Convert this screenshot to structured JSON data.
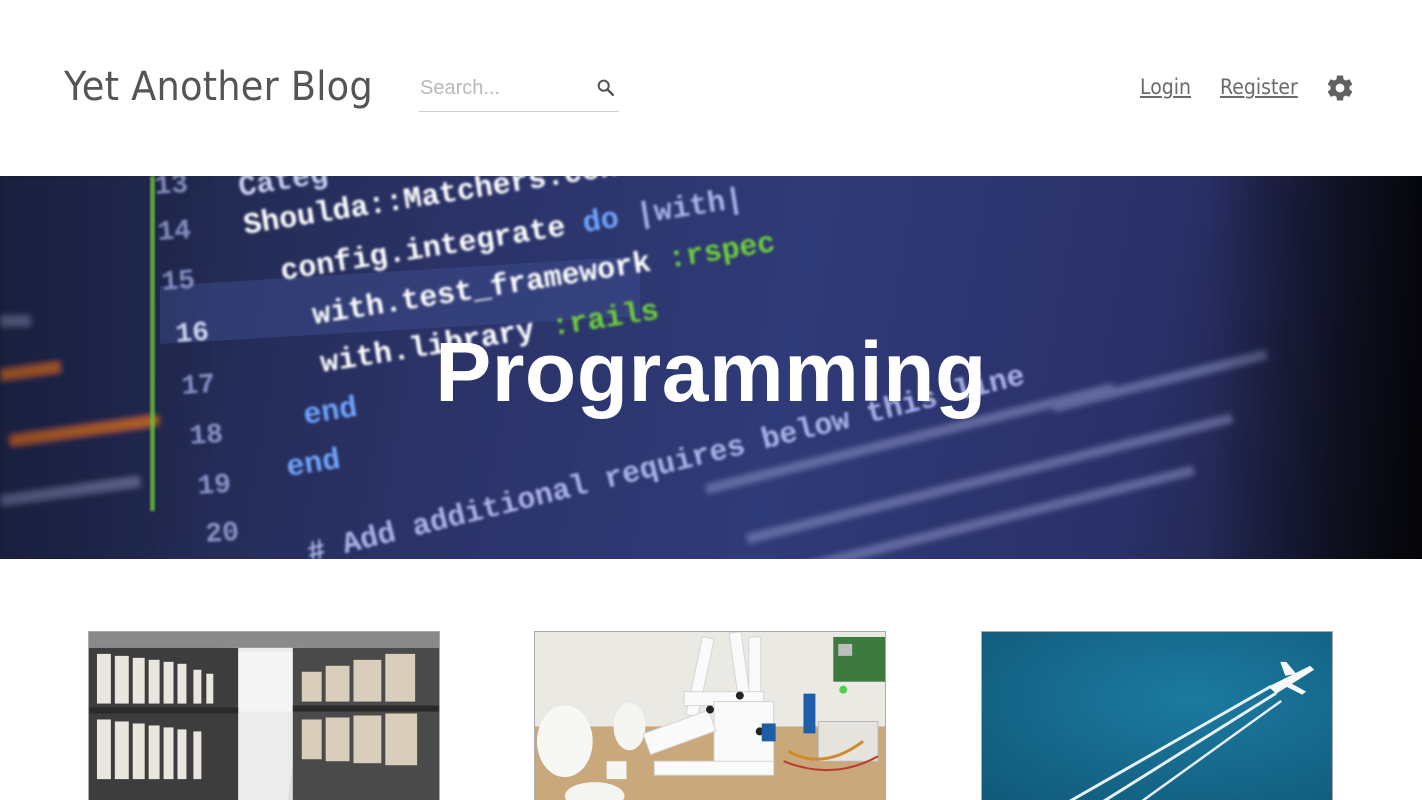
{
  "header": {
    "site_title": "Yet Another Blog",
    "search": {
      "placeholder": "Search...",
      "value": "",
      "icon": "search-icon"
    },
    "nav": {
      "login": "Login",
      "register": "Register",
      "settings_icon": "gear-icon"
    }
  },
  "hero": {
    "title": "Programming",
    "code_lines": [
      {
        "num": "13",
        "text": "Categ..."
      },
      {
        "num": "14",
        "text": "Shoulda::Matchers.configure do |config|"
      },
      {
        "num": "15",
        "text": "config.integrate do |with|"
      },
      {
        "num": "16",
        "text": "with.test_framework :rspec"
      },
      {
        "num": "17",
        "text": "with.library :rails"
      },
      {
        "num": "18",
        "text": "end"
      },
      {
        "num": "19",
        "text": "end"
      },
      {
        "num": "20",
        "text": "# Add additional requires below this line..."
      }
    ]
  },
  "cards": [
    {
      "image": "archive-shelves-image"
    },
    {
      "image": "robot-arm-3d-print-image"
    },
    {
      "image": "airplane-contrails-image"
    }
  ],
  "colors": {
    "hero_base": "#2a3266",
    "accent_green": "#6fcf3a",
    "accent_orange": "#e8761b",
    "sky_blue": "#14678a"
  }
}
